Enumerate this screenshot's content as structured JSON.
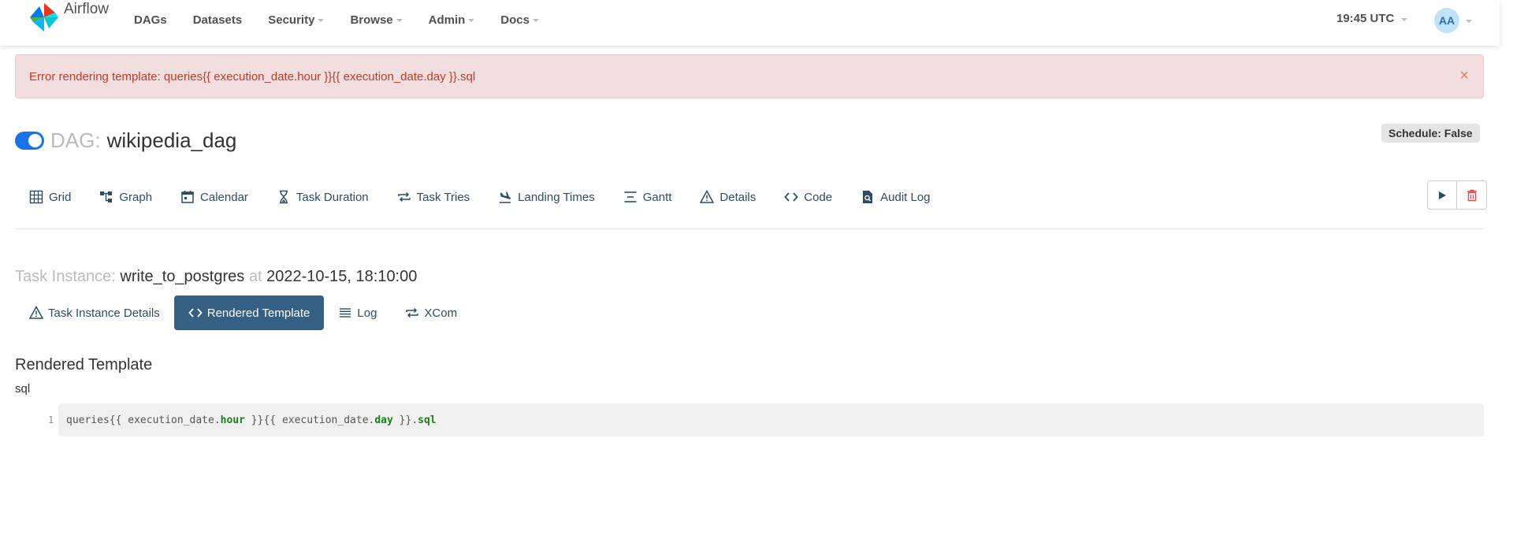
{
  "navbar": {
    "brand": "Airflow",
    "items": [
      {
        "label": "DAGs",
        "dropdown": false
      },
      {
        "label": "Datasets",
        "dropdown": false
      },
      {
        "label": "Security",
        "dropdown": true
      },
      {
        "label": "Browse",
        "dropdown": true
      },
      {
        "label": "Admin",
        "dropdown": true
      },
      {
        "label": "Docs",
        "dropdown": true
      }
    ],
    "time": "19:45 UTC",
    "avatar_initials": "AA"
  },
  "alert": {
    "message": "Error rendering template: queries{{ execution_date.hour }}{{ execution_date.day }}.sql",
    "close_glyph": "×"
  },
  "dag": {
    "prefix": "DAG:",
    "id": "wikipedia_dag",
    "schedule_badge": "Schedule: False",
    "toggle_on": true
  },
  "tabs": [
    {
      "label": "Grid",
      "icon": "grid-icon"
    },
    {
      "label": "Graph",
      "icon": "graph-icon"
    },
    {
      "label": "Calendar",
      "icon": "calendar-icon"
    },
    {
      "label": "Task Duration",
      "icon": "hourglass-icon"
    },
    {
      "label": "Task Tries",
      "icon": "repeat-icon"
    },
    {
      "label": "Landing Times",
      "icon": "plane-landing-icon"
    },
    {
      "label": "Gantt",
      "icon": "gantt-icon"
    },
    {
      "label": "Details",
      "icon": "warning-triangle-icon"
    },
    {
      "label": "Code",
      "icon": "code-icon"
    },
    {
      "label": "Audit Log",
      "icon": "file-search-icon"
    }
  ],
  "task_instance": {
    "label": "Task Instance:",
    "task_id": "write_to_postgres",
    "at": "at",
    "date": "2022-10-15, 18:10:00"
  },
  "subtabs": [
    {
      "label": "Task Instance Details",
      "icon": "warning-triangle-icon",
      "active": false
    },
    {
      "label": "Rendered Template",
      "icon": "code-icon",
      "active": true
    },
    {
      "label": "Log",
      "icon": "list-icon",
      "active": false
    },
    {
      "label": "XCom",
      "icon": "repeat-icon",
      "active": false
    }
  ],
  "rendered": {
    "title": "Rendered Template",
    "field": "sql",
    "line_number": "1",
    "code_parts": [
      {
        "text": "queries{{ execution_date.",
        "kw": false
      },
      {
        "text": "hour",
        "kw": true
      },
      {
        "text": " }}{{ execution_date.",
        "kw": false
      },
      {
        "text": "day",
        "kw": true
      },
      {
        "text": " }}.",
        "kw": false
      },
      {
        "text": "sql",
        "kw": true
      }
    ]
  },
  "colors": {
    "accent": "#365f84",
    "toggle": "#1a73e8",
    "alert_bg": "#f2dede",
    "alert_text": "#c0392b",
    "delete": "#d9534f"
  }
}
